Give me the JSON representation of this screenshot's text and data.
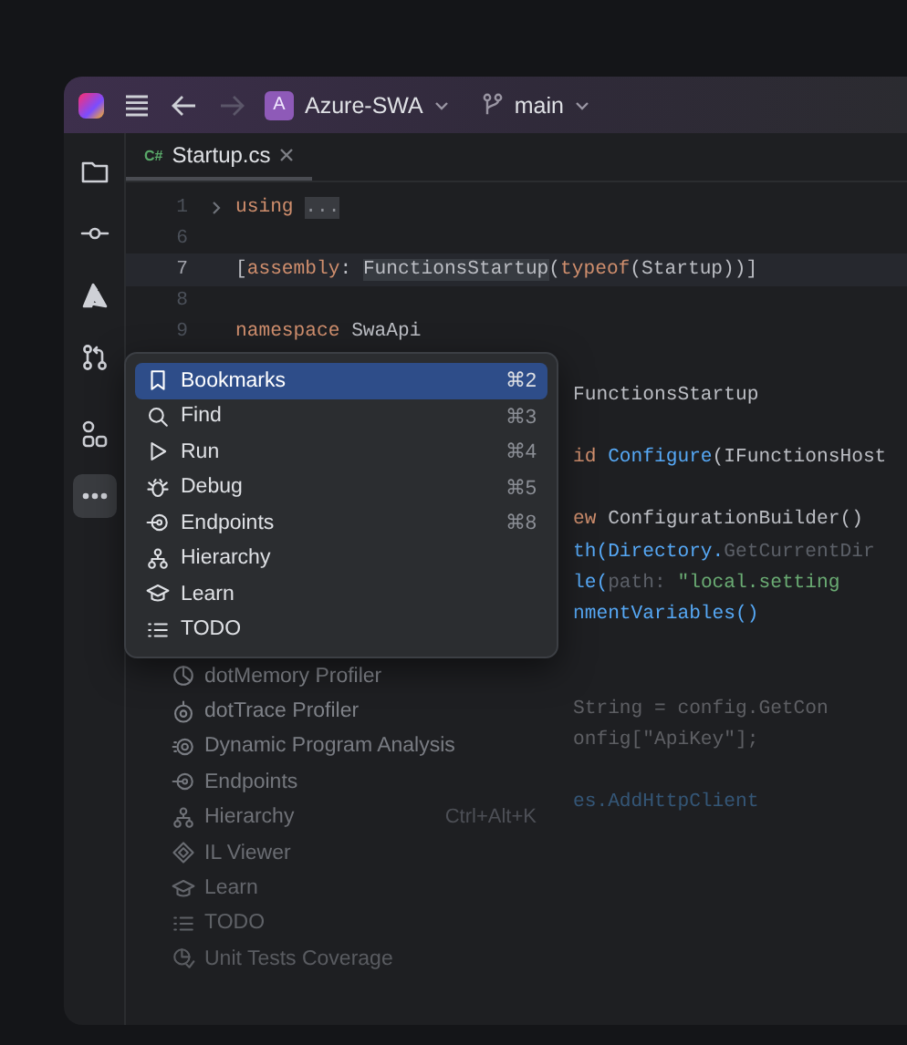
{
  "title_bar": {
    "project_badge": "A",
    "project": "Azure-SWA",
    "branch": "main",
    "forward_disabled": true
  },
  "tool_strip": [
    {
      "kind": "folder",
      "selected": false
    },
    {
      "kind": "commit",
      "selected": false
    },
    {
      "kind": "azure",
      "selected": false
    },
    {
      "kind": "pull-request",
      "selected": false
    },
    {
      "kind": "structure",
      "selected": false
    },
    {
      "kind": "more",
      "selected": true
    }
  ],
  "tab": {
    "file_type": "C#",
    "label": "Startup.cs",
    "selected": true
  },
  "code_lines": [
    {
      "number": "1",
      "kind": "full",
      "current": false,
      "segments": [
        {
          "kind": "keyword",
          "text": "using"
        },
        {
          "kind": "folded",
          "text": "..."
        }
      ]
    },
    {
      "number": "6",
      "kind": "full",
      "current": false
    },
    {
      "number": "7",
      "kind": "full",
      "current": true,
      "segments": [
        {
          "kind": "plain",
          "text": "["
        },
        {
          "kind": "keyword",
          "text": "assembly"
        },
        {
          "kind": "plain",
          "text": ": "
        },
        {
          "kind": "highlight",
          "text": "FunctionsStartup"
        },
        {
          "kind": "plain",
          "text": "("
        },
        {
          "kind": "keyword",
          "text": "typeof"
        },
        {
          "kind": "plain",
          "text": "(Startup))]"
        }
      ]
    },
    {
      "number": "8",
      "kind": "full",
      "current": false
    },
    {
      "number": "9",
      "kind": "full",
      "current": false,
      "segments": [
        {
          "kind": "keyword",
          "text": "namespace"
        },
        {
          "kind": "plain",
          "text": " SwaApi"
        }
      ]
    },
    {
      "kind": "blank"
    },
    {
      "kind": "clipped",
      "dim": false,
      "segments": [
        {
          "kind": "plain",
          "text": "FunctionsStartup"
        }
      ]
    },
    {
      "kind": "blank"
    },
    {
      "kind": "clipped",
      "dim": false,
      "segments": [
        {
          "kind": "keyword",
          "text": "id"
        },
        {
          "kind": "method",
          "text": " Configure"
        },
        {
          "kind": "plain",
          "text": "(IFunctionsHost"
        }
      ]
    },
    {
      "kind": "blank"
    },
    {
      "kind": "clipped",
      "dim": false,
      "segments": [
        {
          "kind": "keyword",
          "text": "ew"
        },
        {
          "kind": "plain",
          "text": " ConfigurationBuilder()"
        }
      ]
    },
    {
      "kind": "clipped",
      "dim": false,
      "segments": [
        {
          "kind": "method",
          "text": "th(Directory."
        },
        {
          "kind": "faint",
          "text": "GetCurrentDir"
        }
      ]
    },
    {
      "kind": "clipped",
      "dim": false,
      "segments": [
        {
          "kind": "method",
          "text": "le("
        },
        {
          "kind": "faint",
          "text": "path: "
        },
        {
          "kind": "string",
          "text": "\"local.setting"
        }
      ]
    },
    {
      "kind": "clipped",
      "dim": false,
      "segments": [
        {
          "kind": "method",
          "text": "nmentVariables()"
        }
      ]
    },
    {
      "kind": "blank"
    },
    {
      "kind": "blank"
    },
    {
      "kind": "clipped",
      "dim": true,
      "segments": [
        {
          "kind": "plain",
          "text": "String = config.GetCon"
        }
      ]
    },
    {
      "kind": "clipped",
      "dim": true,
      "segments": [
        {
          "kind": "plain",
          "text": "onfig[\"ApiKey\"];"
        }
      ]
    },
    {
      "kind": "blank"
    },
    {
      "kind": "clipped",
      "dim": true,
      "segments": [
        {
          "kind": "method",
          "text": "es.AddHttpClient"
        }
      ]
    }
  ],
  "popup_menu": [
    {
      "kind": "bookmark",
      "label": "Bookmarks",
      "shortcut": "⌘2",
      "selected": true
    },
    {
      "kind": "find",
      "label": "Find",
      "shortcut": "⌘3",
      "selected": false
    },
    {
      "kind": "run",
      "label": "Run",
      "shortcut": "⌘4",
      "selected": false
    },
    {
      "kind": "debug",
      "label": "Debug",
      "shortcut": "⌘5",
      "selected": false
    },
    {
      "kind": "endpoints",
      "label": "Endpoints",
      "shortcut": "⌘8",
      "selected": false
    },
    {
      "kind": "hierarchy",
      "label": "Hierarchy",
      "selected": false
    },
    {
      "kind": "learn",
      "label": "Learn",
      "selected": false
    },
    {
      "kind": "todo",
      "label": "TODO",
      "selected": false
    }
  ],
  "faded_menu": [
    {
      "kind": "memory",
      "label": "dotMemory Profiler"
    },
    {
      "kind": "trace",
      "label": "dotTrace Profiler"
    },
    {
      "kind": "dpa",
      "label": "Dynamic Program Analysis"
    },
    {
      "kind": "endpoints",
      "label": "Endpoints"
    },
    {
      "kind": "hierarchy",
      "label": "Hierarchy",
      "shortcut": "Ctrl+Alt+K"
    },
    {
      "kind": "il",
      "label": "IL Viewer"
    },
    {
      "kind": "learn",
      "label": "Learn"
    },
    {
      "kind": "todo",
      "label": "TODO"
    },
    {
      "kind": "coverage",
      "label": "Unit Tests Coverage"
    }
  ]
}
